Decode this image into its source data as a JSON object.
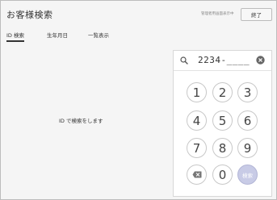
{
  "header": {
    "title": "お客様検索",
    "note": "管理者用画面表示中",
    "exit_label": "終了"
  },
  "tabs": [
    {
      "label": "ID 検索",
      "active": true
    },
    {
      "label": "生年月日",
      "active": false
    },
    {
      "label": "一覧表示",
      "active": false
    }
  ],
  "main": {
    "message": "ID で検索をします"
  },
  "keypad": {
    "search_value": "2234-____",
    "keys": [
      "1",
      "2",
      "3",
      "4",
      "5",
      "6",
      "7",
      "8",
      "9"
    ],
    "zero": "0",
    "search_label": "検索",
    "icons": {
      "search": "search-icon",
      "clear": "clear-icon",
      "backspace": "backspace-icon"
    }
  },
  "colors": {
    "search_key_bg": "#c8cbe6",
    "background": "#f5f5f5"
  }
}
